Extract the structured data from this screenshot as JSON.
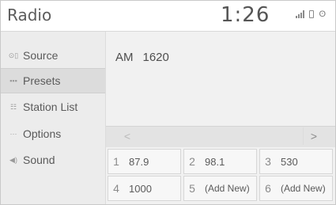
{
  "header": {
    "title": "Radio",
    "clock": "1:26",
    "status_icons": [
      "signal-icon",
      "phone-battery-icon",
      "bluetooth-icon"
    ]
  },
  "sidebar": {
    "items": [
      {
        "label": "Source",
        "icon": "source-icon",
        "active": false
      },
      {
        "label": "Presets",
        "icon": "presets-icon",
        "active": true
      },
      {
        "label": "Station List",
        "icon": "station-list-icon",
        "active": false
      },
      {
        "label": "Options",
        "icon": "options-icon",
        "active": false
      },
      {
        "label": "Sound",
        "icon": "sound-icon",
        "active": false
      }
    ]
  },
  "main": {
    "band": "AM",
    "frequency": "1620",
    "prev_label": "<",
    "next_label": ">",
    "presets": [
      {
        "number": "1",
        "value": "87.9"
      },
      {
        "number": "2",
        "value": "98.1"
      },
      {
        "number": "3",
        "value": "530"
      },
      {
        "number": "4",
        "value": "1000"
      },
      {
        "number": "5",
        "value": "(Add New)"
      },
      {
        "number": "6",
        "value": "(Add New)"
      }
    ]
  }
}
